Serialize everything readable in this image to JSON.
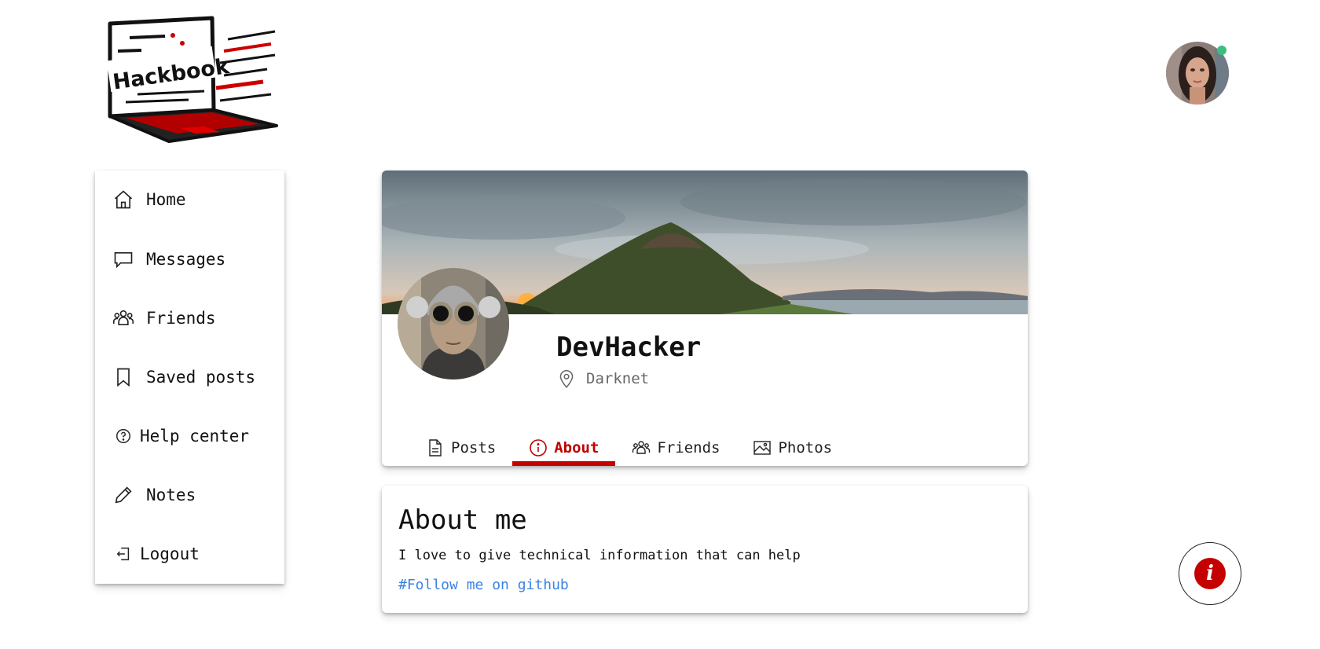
{
  "brand": {
    "logo_text": "Hackbook"
  },
  "sidebar": {
    "items": [
      {
        "label": "Home",
        "icon": "home-icon"
      },
      {
        "label": "Messages",
        "icon": "message-icon"
      },
      {
        "label": "Friends",
        "icon": "users-icon"
      },
      {
        "label": "Saved posts",
        "icon": "bookmark-icon"
      },
      {
        "label": "Help center",
        "icon": "help-icon"
      },
      {
        "label": "Notes",
        "icon": "pencil-icon"
      },
      {
        "label": "Logout",
        "icon": "logout-icon"
      }
    ]
  },
  "profile": {
    "name": "DevHacker",
    "location": "Darknet"
  },
  "tabs": [
    {
      "label": "Posts",
      "icon": "document-icon",
      "active": false
    },
    {
      "label": "About",
      "icon": "info-icon",
      "active": true
    },
    {
      "label": "Friends",
      "icon": "users-icon",
      "active": false
    },
    {
      "label": "Photos",
      "icon": "image-icon",
      "active": false
    }
  ],
  "about": {
    "title": "About me",
    "text": "I love to give technical information that can help",
    "link": "#Follow me on github"
  },
  "info_button": {
    "glyph": "i"
  },
  "colors": {
    "accent": "#c40000",
    "link": "#3b82e4",
    "online": "#3bbf7d"
  }
}
